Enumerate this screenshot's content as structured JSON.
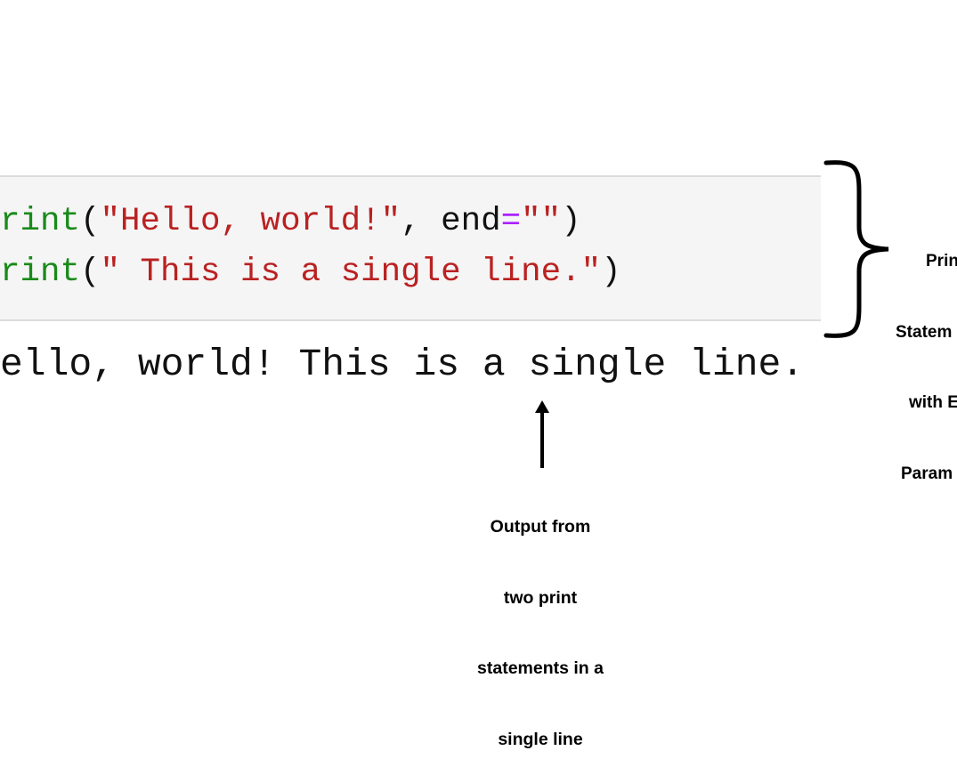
{
  "code_cell": {
    "lines": [
      {
        "func": "rint",
        "open": "(",
        "str1": "\"Hello, world!\"",
        "sep": ", end",
        "eq": "=",
        "str2": "\"\"",
        "close": ")"
      },
      {
        "func": "rint",
        "open": "(",
        "str1": "\" This is a single line.\"",
        "close": ")"
      }
    ],
    "colors": {
      "function": "#1a8a1a",
      "string": "#ba2121",
      "operator": "#aa22ff",
      "background": "#f5f5f5"
    }
  },
  "output": {
    "text": "ello, world! This is a single line."
  },
  "annotations": {
    "bottom_label": [
      "Output from",
      "two print",
      "statements in a",
      "single line"
    ],
    "right_label": [
      "Prin",
      "Statem",
      "with E",
      "Param"
    ]
  }
}
